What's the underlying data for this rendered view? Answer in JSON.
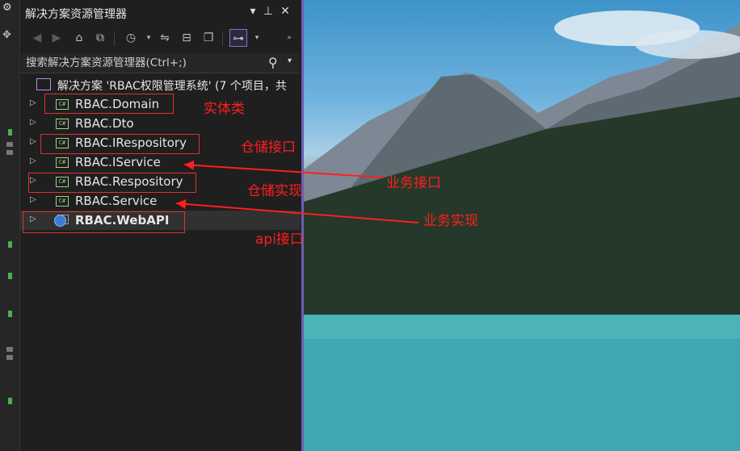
{
  "panel": {
    "title": "解决方案资源管理器",
    "search_placeholder": "搜索解决方案资源管理器(Ctrl+;)"
  },
  "solution": {
    "label": "解决方案 'RBAC权限管理系统' (7 个项目，共"
  },
  "projects": [
    {
      "label": "RBAC.Domain",
      "icon": "csharp-project-icon"
    },
    {
      "label": "RBAC.Dto",
      "icon": "csharp-project-icon"
    },
    {
      "label": "RBAC.IRespository",
      "icon": "csharp-project-icon"
    },
    {
      "label": "RBAC.IService",
      "icon": "csharp-project-icon"
    },
    {
      "label": "RBAC.Respository",
      "icon": "csharp-project-icon"
    },
    {
      "label": "RBAC.Service",
      "icon": "csharp-project-icon"
    },
    {
      "label": "RBAC.WebAPI",
      "icon": "web-project-icon"
    }
  ],
  "annotations": {
    "entity": "实体类",
    "repo_interface": "仓储接口",
    "service_interface": "业务接口",
    "repo_impl": "仓储实现",
    "service_impl": "业务实现",
    "api_interface": "api接口"
  },
  "colors": {
    "annotation": "#ff1f1f",
    "panel_bg": "#1f1f1f",
    "accent": "#8a6fd6"
  }
}
